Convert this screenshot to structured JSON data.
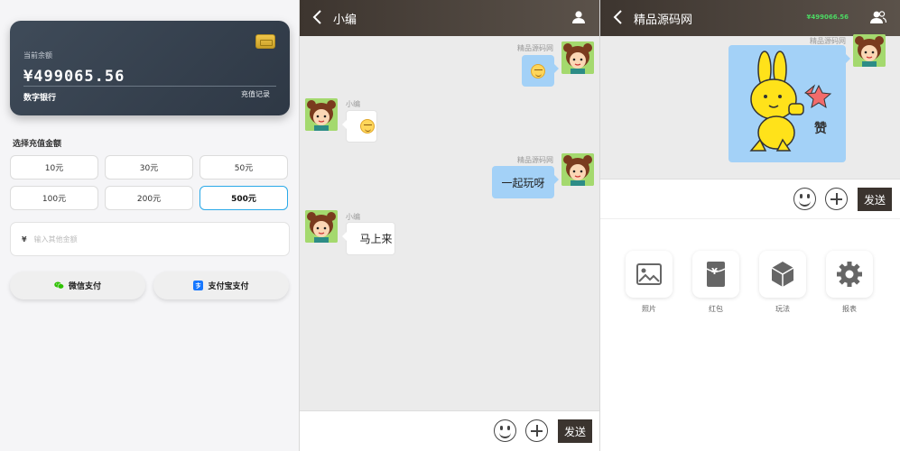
{
  "wallet": {
    "balance_label": "当前余额",
    "balance": "¥499065.56",
    "bank_name": "数字银行",
    "records_link": "充值记录",
    "select_title": "选择充值金额",
    "amounts": [
      "10元",
      "30元",
      "50元",
      "100元",
      "200元",
      "500元"
    ],
    "selected_amount": "500元",
    "other_currency": "¥",
    "other_placeholder": "输入其他金额",
    "wechat_pay": "微信支付",
    "alipay": "支付宝支付"
  },
  "chat": {
    "title": "小编",
    "messages": [
      {
        "sender": "精品源码网",
        "side": "right",
        "type": "emoji"
      },
      {
        "sender": "小编",
        "side": "left",
        "type": "emoji"
      },
      {
        "sender": "精品源码网",
        "side": "right",
        "type": "text",
        "text": "一起玩呀"
      },
      {
        "sender": "小编",
        "side": "left",
        "type": "text",
        "text": "马上来"
      }
    ],
    "send_label": "发送"
  },
  "chat2": {
    "title": "精品源码网",
    "balance": "¥499066.56",
    "sender": "精品源码网",
    "sticker_text": "赞",
    "send_label": "发送",
    "tools": [
      "照片",
      "红包",
      "玩法",
      "报表"
    ],
    "red_packet_symbol": "¥"
  },
  "colors": {
    "header_bg": "#3d352f",
    "bubble_self": "#a3d1f7",
    "selected_border": "#2aa9e8",
    "balance_green": "#4cd963"
  }
}
